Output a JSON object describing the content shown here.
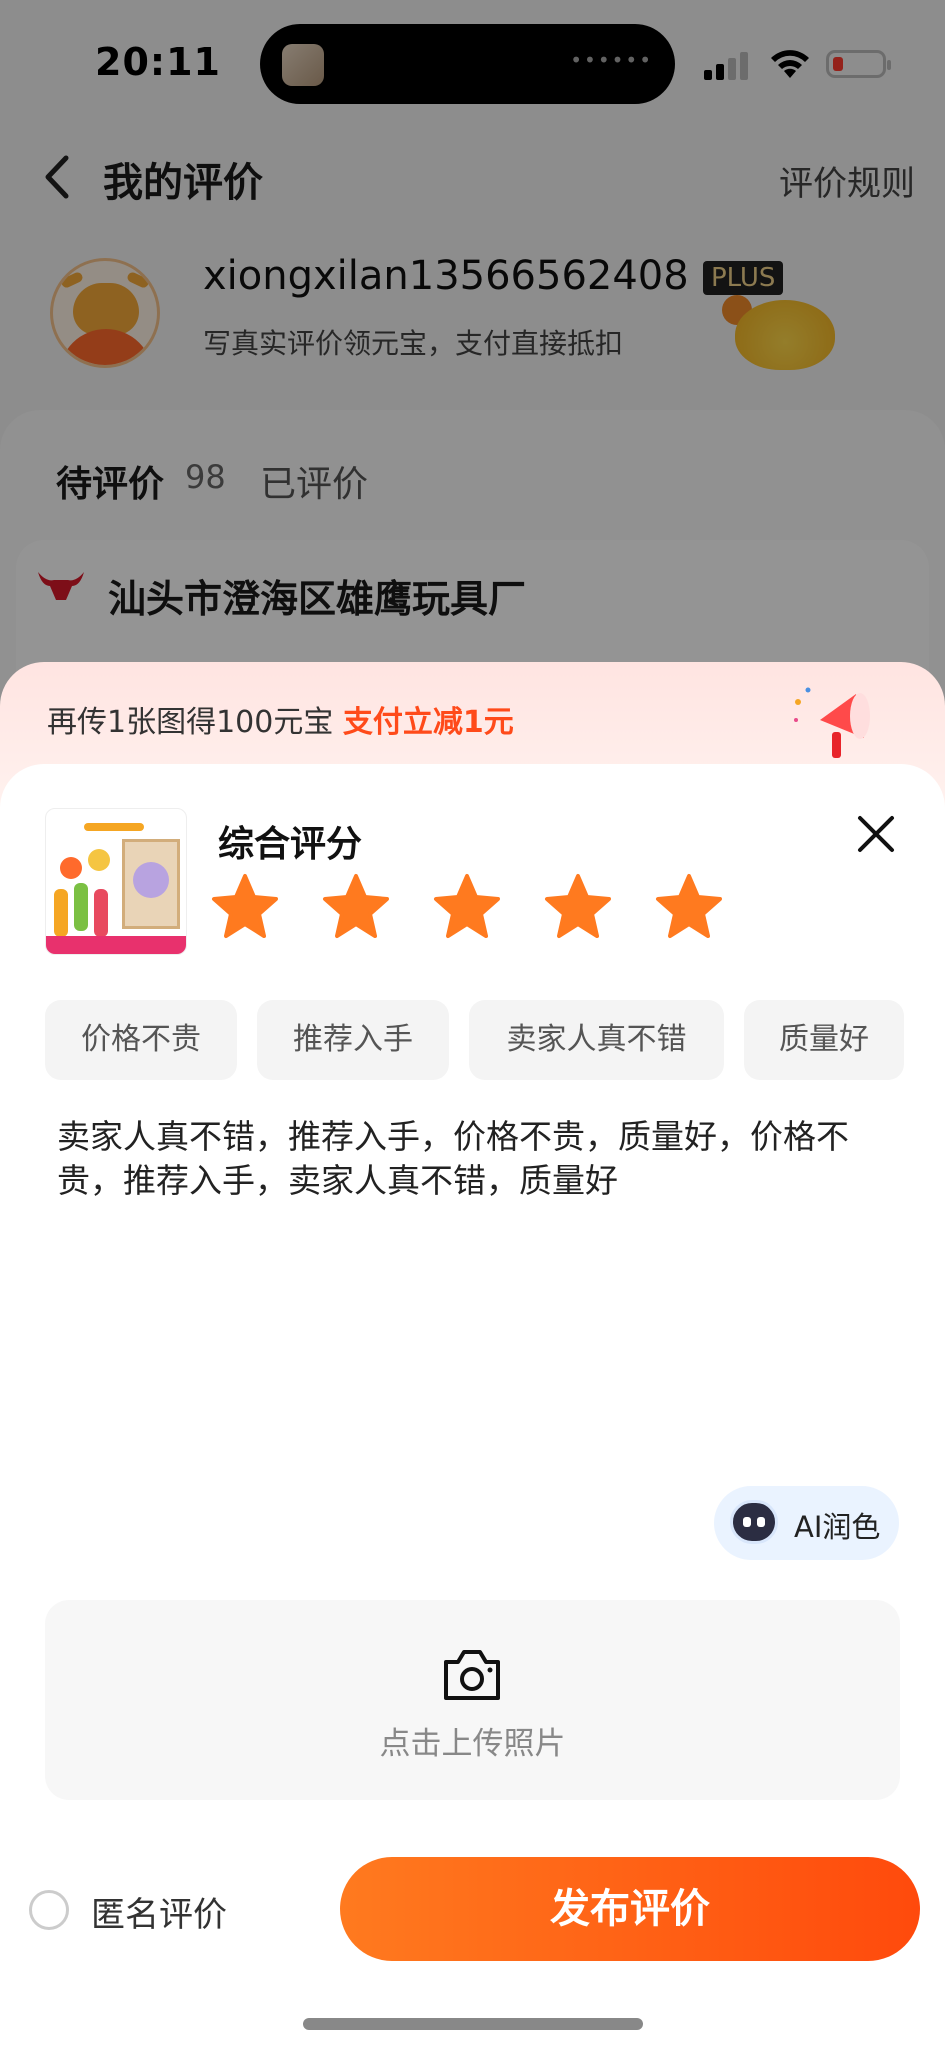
{
  "status_bar": {
    "time": "20:11"
  },
  "header": {
    "title": "我的评价",
    "rules_link": "评价规则"
  },
  "profile": {
    "username": "xiongxilan13566562408",
    "badge": "PLUS",
    "promo": "写真实评价领元宝，支付直接抵扣"
  },
  "tabs": {
    "pending_label": "待评价",
    "pending_count": "98",
    "done_label": "已评价"
  },
  "order": {
    "shop_name": "汕头市澄海区雄鹰玩具厂"
  },
  "sheet": {
    "bonus_prefix": "再传1张图得100元宝 ",
    "bonus_highlight": "支付立减1元",
    "rating_title": "综合评分",
    "rating_value": 5,
    "rating_max": 5,
    "tags": [
      "价格不贵",
      "推荐入手",
      "卖家人真不错",
      "质量好"
    ],
    "review_text": "卖家人真不错，推荐入手，价格不贵，质量好，价格不贵，推荐入手，卖家人真不错，质量好",
    "ai_button": "AI润色",
    "upload_hint": "点击上传照片",
    "anonymous_label": "匿名评价",
    "publish_button": "发布评价"
  },
  "colors": {
    "accent": "#ff5a14",
    "star": "#ff7a1f",
    "ai_bg": "#eaf3ff"
  }
}
